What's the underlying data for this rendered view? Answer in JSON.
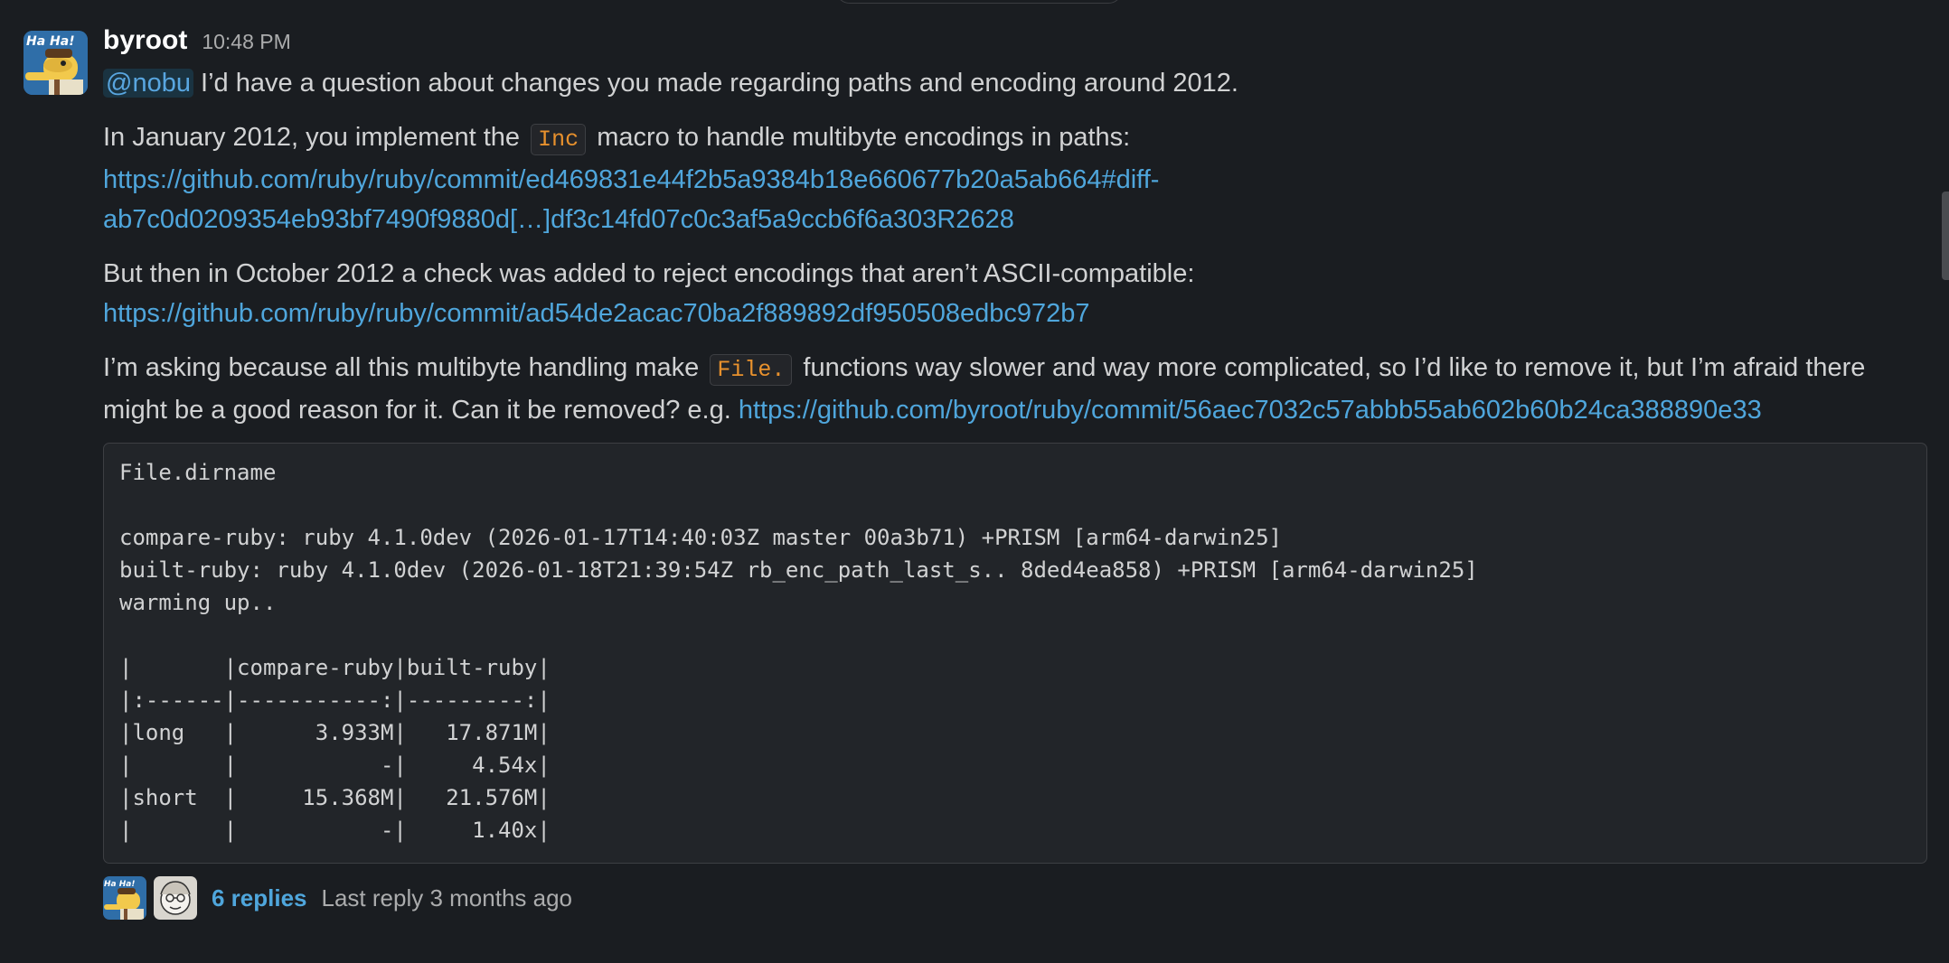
{
  "message": {
    "author": "byroot",
    "timestamp": "10:48 PM",
    "mention": "@nobu",
    "line1_rest": " I’d have a question about changes you made regarding paths and encoding around 2012.",
    "p2_before": "In January 2012, you implement the ",
    "p2_code": "Inc",
    "p2_after": " macro to handle multibyte encodings in paths:",
    "p2_link_line1": "https://github.com/ruby/ruby/commit/ed469831e44f2b5a9384b18e660677b20a5ab664#diff-",
    "p2_link_line2": "ab7c0d0209354eb93bf7490f9880d[…]df3c14fd07c0c3af5a9ccb6f6a303R2628",
    "p3_text": "But then in October 2012 a check was added to reject encodings that aren’t ASCII-compatible:",
    "p3_link": "https://github.com/ruby/ruby/commit/ad54de2acac70ba2f889892df950508edbc972b7",
    "p4_before": "I’m asking because all this multibyte handling make ",
    "p4_code": "File.",
    "p4_after": " functions way slower and way more complicated, so I’d like to remove it, but I’m afraid there",
    "p4_line2": "might be a good reason for it. Can it be removed? e.g. ",
    "p4_link": "https://github.com/byroot/ruby/commit/56aec7032c57abbb55ab602b60b24ca388890e33",
    "code_lines": [
      "File.dirname",
      "",
      "compare-ruby: ruby 4.1.0dev (2026-01-17T14:40:03Z master 00a3b71) +PRISM [arm64-darwin25]",
      "built-ruby: ruby 4.1.0dev (2026-01-18T21:39:54Z rb_enc_path_last_s.. 8ded4ea858) +PRISM [arm64-darwin25]",
      "warming up..",
      "",
      "|       |compare-ruby|built-ruby|",
      "|:------|-----------:|---------:|",
      "|long   |      3.933M|   17.871M|",
      "|       |           -|     4.54x|",
      "|short  |     15.368M|   21.576M|",
      "|       |           -|     1.40x|"
    ]
  },
  "thread": {
    "replies": "6 replies",
    "last_reply": "Last reply 3 months ago"
  },
  "avatar_text": "Ha Ha!",
  "colors": {
    "background": "#1a1d21",
    "link": "#4fa6dc",
    "inline_code": "#e8912d"
  }
}
